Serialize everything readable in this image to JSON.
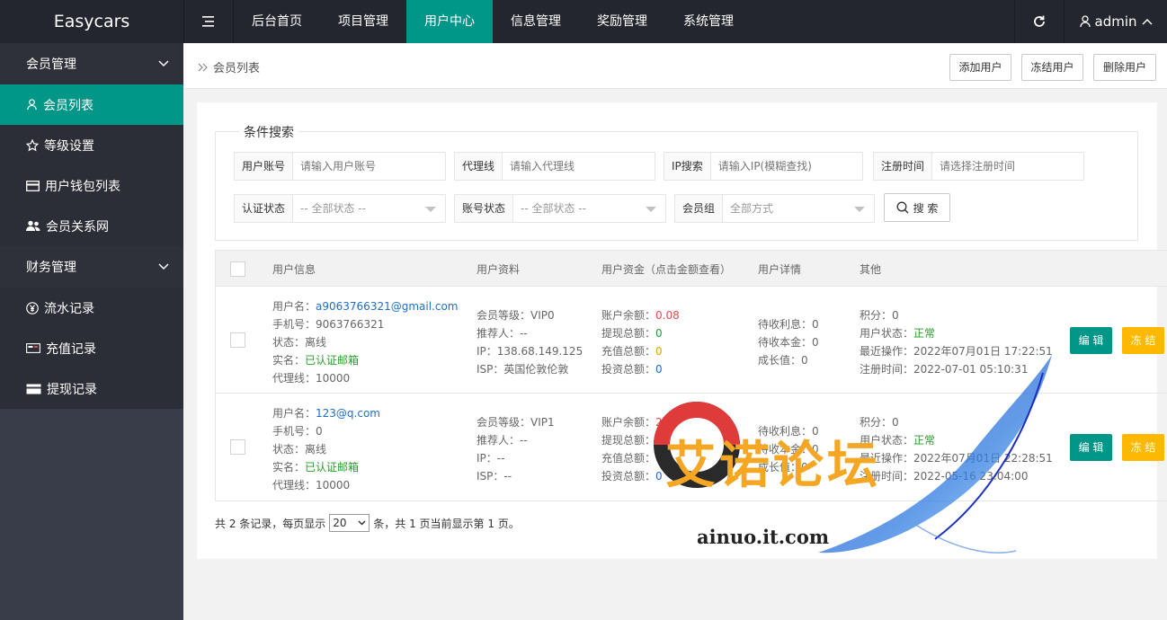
{
  "app": {
    "logo": "Easycars"
  },
  "topnav": {
    "items": [
      "后台首页",
      "项目管理",
      "用户中心",
      "信息管理",
      "奖励管理",
      "系统管理"
    ],
    "active_index": 2,
    "user": "admin"
  },
  "sidebar": {
    "groups": [
      {
        "label": "会员管理",
        "items": [
          {
            "label": "会员列表",
            "icon": "user-icon",
            "active": true
          },
          {
            "label": "等级设置",
            "icon": "star-icon"
          },
          {
            "label": "用户钱包列表",
            "icon": "card-icon"
          },
          {
            "label": "会员关系网",
            "icon": "users-icon"
          }
        ]
      },
      {
        "label": "财务管理",
        "items": [
          {
            "label": "流水记录",
            "icon": "yen-icon"
          },
          {
            "label": "充值记录",
            "icon": "recharge-icon"
          },
          {
            "label": "提现记录",
            "icon": "withdraw-icon"
          }
        ]
      }
    ]
  },
  "breadcrumb": {
    "current": "会员列表"
  },
  "toolbar": {
    "add": "添加用户",
    "freeze": "冻结用户",
    "delete": "删除用户"
  },
  "search": {
    "legend": "条件搜索",
    "account": {
      "label": "用户账号",
      "placeholder": "请输入用户账号"
    },
    "agent": {
      "label": "代理线",
      "placeholder": "请输入代理线"
    },
    "ip": {
      "label": "IP搜索",
      "placeholder": "请输入IP(模糊查找)"
    },
    "regtime": {
      "label": "注册时间",
      "placeholder": "请选择注册时间"
    },
    "auth": {
      "label": "认证状态",
      "value": "-- 全部状态 --"
    },
    "status": {
      "label": "账号状态",
      "value": "-- 全部状态 --"
    },
    "group": {
      "label": "会员组",
      "value": "全部方式"
    },
    "button": "搜 索"
  },
  "table": {
    "headers": [
      "用户信息",
      "用户资料",
      "用户资金（点击金额查看）",
      "用户详情",
      "其他"
    ],
    "rows": [
      {
        "info": {
          "username_label": "用户名：",
          "username": "a9063766321@gmail.com",
          "phone": "手机号：9063766321",
          "status_label": "状态：",
          "status": "离线",
          "realname_label": "实名：",
          "realname": "已认证邮箱",
          "agent": "代理线：10000"
        },
        "profile": {
          "level": "会员等级：VIP0",
          "referrer": "推荐人：--",
          "ip": "IP：138.68.149.125",
          "isp": "ISP：英国伦敦伦敦"
        },
        "funds": {
          "balance_label": "账户余额：",
          "balance": "0.08",
          "withdraw_label": "提现总额：",
          "withdraw": "0",
          "recharge_label": "充值总额：",
          "recharge": "0",
          "invest_label": "投资总额：",
          "invest": "0"
        },
        "detail": {
          "interest": "待收利息：0",
          "principal": "待收本金：0",
          "growth": "成长值：0"
        },
        "other": {
          "points": "积分：0",
          "state_label": "用户状态：",
          "state": "正常",
          "last_op": "最近操作：2022年07月01日 17:22:51",
          "reg_time": "注册时间：2022-07-01 05:10:31"
        },
        "edit": "编 辑",
        "freeze": "冻 结"
      },
      {
        "info": {
          "username_label": "用户名：",
          "username": "123@q.com",
          "phone": "手机号：0",
          "status_label": "状态：",
          "status": "离线",
          "realname_label": "实名：",
          "realname": "已认证邮箱",
          "agent": "代理线：10000"
        },
        "profile": {
          "level": "会员等级：VIP1",
          "referrer": "推荐人：--",
          "ip": "IP：--",
          "isp": "ISP：--"
        },
        "funds": {
          "balance_label": "账户余额：",
          "balance": "2403",
          "withdraw_label": "提现总额：",
          "withdraw": "0",
          "recharge_label": "充值总额：",
          "recharge": "0",
          "invest_label": "投资总额：",
          "invest": "0"
        },
        "detail": {
          "interest": "待收利息：0",
          "principal": "待收本金：0",
          "growth": "成长值：0"
        },
        "other": {
          "points": "积分：0",
          "state_label": "用户状态：",
          "state": "正常",
          "last_op": "最近操作：2022年07月01日 22:28:51",
          "reg_time": "注册时间：2022-05-16 23:04:00"
        },
        "edit": "编 辑",
        "freeze": "冻 结"
      }
    ]
  },
  "pager": {
    "prefix": "共 2 条记录，每页显示",
    "page_size": "20",
    "suffix": "条，共 1 页当前显示第 1 页。"
  },
  "watermark": {
    "title": "艾诺论坛",
    "url": "ainuo.it.com"
  },
  "colors": {
    "accent": "#009688",
    "warn": "#ffb800",
    "dark": "#23262e"
  }
}
